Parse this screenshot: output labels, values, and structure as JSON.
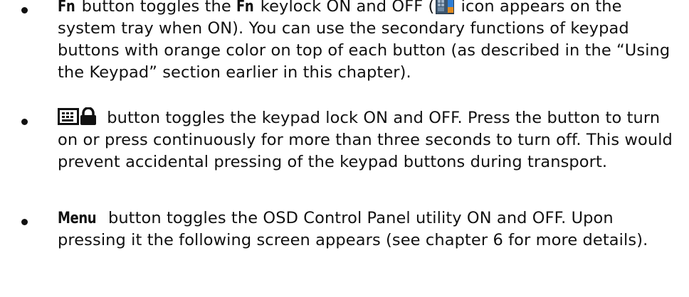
{
  "items": [
    {
      "keyword": "Fn",
      "segments": {
        "a": " button toggles the ",
        "kw2": "Fn",
        "b": " keylock ON and OFF (",
        "c": " icon appears on the system tray when ON). You can use the secondary functions of keypad buttons with orange color on top of each button (as described in the “Using the Keypad” section earlier in this chapter)."
      },
      "icon": "fn-lock-tray-icon"
    },
    {
      "icon": "keypad-lock-icon",
      "text": " button toggles the keypad lock ON and OFF. Press the button to turn on or press continuously for more than three seconds to turn off. This would prevent accidental pressing of the keypad buttons during transport."
    },
    {
      "keyword": "Menu",
      "text": " button toggles the OSD Control Panel utility ON and OFF. Upon pressing it the following screen appears (see chapter 6 for more details)."
    }
  ],
  "colors": {
    "text": "#111111",
    "tray_icon_dark": "#2b3a4a",
    "tray_icon_blue": "#2f7fd6",
    "tray_icon_orange": "#e08a1e"
  }
}
